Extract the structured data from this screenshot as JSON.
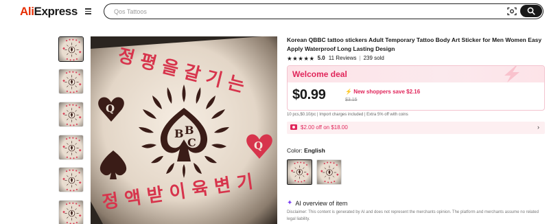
{
  "header": {
    "logo_ali": "Ali",
    "logo_express": "Express",
    "search_placeholder": "Qos Tattoos"
  },
  "product": {
    "title": "Korean QBBC tattoo stickers Adult Temporary Tattoo Body Art Sticker for Men Women Easy Apply Waterproof Long Lasting Design",
    "rating": {
      "stars": 5,
      "score": "5.0",
      "reviews": "11 Reviews",
      "separator": "|",
      "sold": "239 sold"
    },
    "image_text": {
      "cards": "QBBC",
      "korean_top": "정 평 을 갈 기 는",
      "korean_bottom": "정 액 받 이 육 변 기"
    }
  },
  "deal": {
    "title": "Welcome deal",
    "price": "$0.99",
    "save": "New shoppers save $2.16",
    "original_price": "$3.15",
    "sub_price": "10 pcs,$0.10/pc  |  Import charges included  |  Extra 5% off with coins",
    "coupon": "$2.00 off on $18.00"
  },
  "variant": {
    "label": "Color:",
    "value": "English"
  },
  "ai": {
    "title": "AI overview of item",
    "disclaimer": "Disclaimer: This content is generated by AI and does not represent the merchants opinion. The platform and merchants assume no related legal liability."
  },
  "colors": {
    "brand": "#e62e04",
    "deal_pink": "#e0255a",
    "ai_purple": "#7b3ff2"
  },
  "icons": [
    "hamburger-menu-icon",
    "camera-search-icon",
    "search-icon",
    "star-icon",
    "lightning-icon",
    "coupon-icon",
    "chevron-right-icon",
    "ai-sparkle-icon"
  ]
}
